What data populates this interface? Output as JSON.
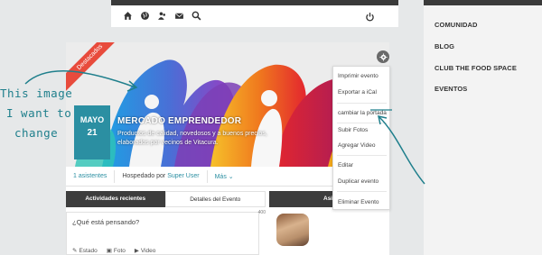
{
  "nav": {
    "icons": [
      "home-icon",
      "globe-icon",
      "people-icon",
      "mail-icon",
      "search-icon",
      "power-icon"
    ]
  },
  "sidebar": {
    "items": [
      {
        "label": "COMUNIDAD"
      },
      {
        "label": "BLOG"
      },
      {
        "label": "CLUB THE FOOD SPACE"
      },
      {
        "label": "EVENTOS"
      }
    ]
  },
  "event": {
    "ribbon": "Destacados",
    "month": "MAYO",
    "day": "21",
    "title": "MERCADO EMPRENDEDOR",
    "description": "Productos de calidad, novedosos y a buenos precios, elaborados por vecinos de Vitacura.",
    "attendees": "1 asistentes",
    "hosted_prefix": "Hospedado por",
    "host": "Super User",
    "more": "Más",
    "more_icon": "chevron-down-icon"
  },
  "tabs": {
    "recent": "Actividades recientes",
    "details": "Detalles del Evento",
    "attendees": "Asis"
  },
  "composer": {
    "placeholder": "¿Qué está pensando?",
    "count": "400",
    "status": "Estado",
    "photo": "Foto",
    "video": "Video"
  },
  "menu": {
    "items": [
      "Imprimir evento",
      "Exportar a iCal",
      "cambiar la portada",
      "Subir Fotos",
      "Agregar Video",
      "Editar",
      "Duplicar evento",
      "Eliminar Evento"
    ]
  },
  "annotation": {
    "line1": "This image",
    "line2": "I want to",
    "line3": "change"
  },
  "colors": {
    "accent": "#2b8fa2",
    "ribbon": "#e84b3c",
    "dark": "#3d3d3d",
    "annotation": "#1f7f8c"
  }
}
